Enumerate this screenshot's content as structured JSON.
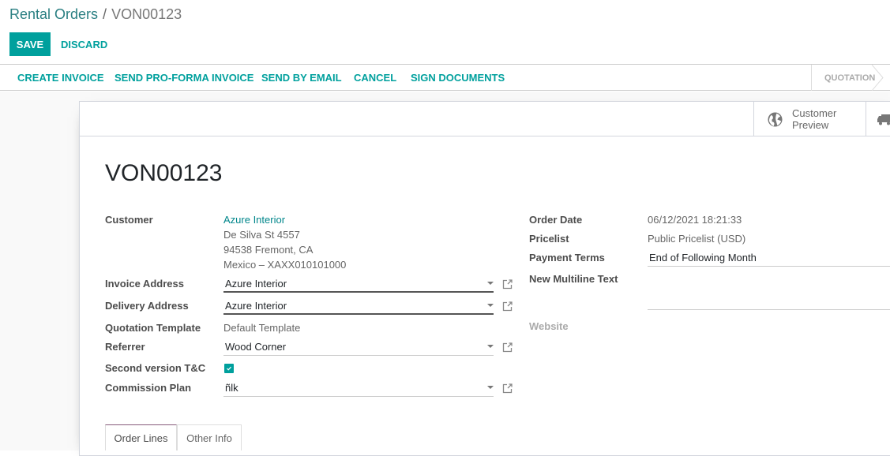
{
  "breadcrumb": {
    "parent": "Rental Orders",
    "separator": "/",
    "current": "VON00123"
  },
  "toolbar": {
    "save_label": "SAVE",
    "discard_label": "DISCARD"
  },
  "statusbar": {
    "actions": [
      "CREATE INVOICE",
      "SEND PRO-FORMA INVOICE",
      "SEND BY EMAIL",
      "CANCEL",
      "SIGN DOCUMENTS"
    ],
    "state": "QUOTATION"
  },
  "button_box": {
    "customer_preview": [
      "Customer",
      "Preview"
    ]
  },
  "form": {
    "title": "VON00123",
    "left": {
      "customer_label": "Customer",
      "customer_name": "Azure Interior",
      "customer_address": [
        "De Silva St 4557",
        "94538 Fremont, CA",
        "Mexico – XAXX010101000"
      ],
      "invoice_address_label": "Invoice Address",
      "invoice_address_value": "Azure Interior",
      "delivery_address_label": "Delivery Address",
      "delivery_address_value": "Azure Interior",
      "quotation_template_label": "Quotation Template",
      "quotation_template_value": "Default Template",
      "referrer_label": "Referrer",
      "referrer_value": "Wood Corner",
      "second_version_label": "Second version T&C",
      "second_version_checked": true,
      "commission_plan_label": "Commission Plan",
      "commission_plan_value": "ñlk"
    },
    "right": {
      "order_date_label": "Order Date",
      "order_date_value": "06/12/2021 18:21:33",
      "pricelist_label": "Pricelist",
      "pricelist_value": "Public Pricelist (USD)",
      "payment_terms_label": "Payment Terms",
      "payment_terms_value": "End of Following Month",
      "multiline_label": "New Multiline Text",
      "multiline_value": "",
      "website_label": "Website"
    }
  },
  "tabs": [
    "Order Lines",
    "Other Info"
  ],
  "colors": {
    "primary": "#00a09d",
    "link": "#00868b",
    "tab_accent": "#875a7b"
  }
}
